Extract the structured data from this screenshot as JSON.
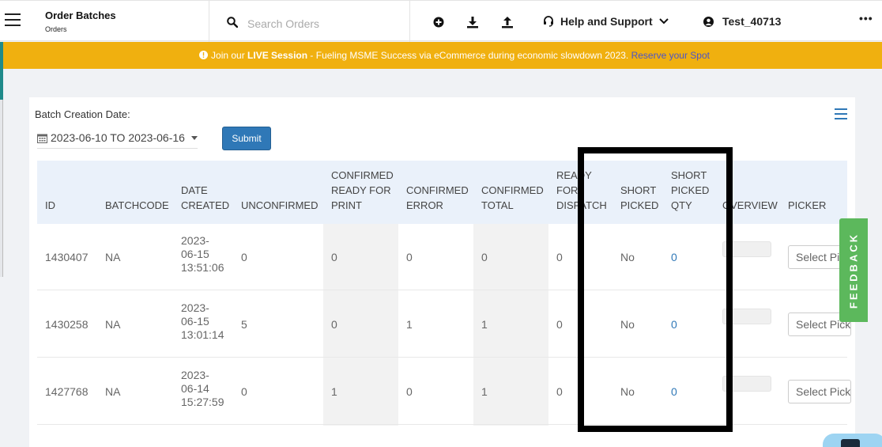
{
  "header": {
    "title": "Order Batches",
    "subtitle": "Orders",
    "search_placeholder": "Search Orders",
    "help_label": "Help and Support",
    "user_label": "Test_40713",
    "more_label": "•••"
  },
  "banner": {
    "prefix": "Join our ",
    "highlight": "LIVE Session",
    "text": " - Fueling MSME Success via eCommerce during economic slowdown 2023. ",
    "link": "Reserve your Spot"
  },
  "filters": {
    "date_label": "Batch Creation Date:",
    "date_range": "2023-06-10 TO 2023-06-16",
    "submit_label": "Submit"
  },
  "table": {
    "columns": [
      [
        "ID"
      ],
      [
        "BATCHCODE"
      ],
      [
        "DATE",
        "CREATED"
      ],
      [
        "UNCONFIRMED"
      ],
      [
        "CONFIRMED",
        "READY FOR",
        "PRINT"
      ],
      [
        "CONFIRMED",
        "ERROR"
      ],
      [
        "CONFIRMED",
        "TOTAL"
      ],
      [
        "READY",
        "FOR",
        "DISPATCH"
      ],
      [
        "SHORT",
        "PICKED"
      ],
      [
        "SHORT",
        "PICKED",
        "QTY"
      ],
      [
        "OVERVIEW"
      ],
      [
        "PICKER"
      ]
    ],
    "rows": [
      {
        "id": "1430407",
        "batchcode": "NA",
        "date": [
          "2023-",
          "06-15",
          "13:51:06"
        ],
        "unconfirmed": "0",
        "ready_print": "0",
        "error": "0",
        "total": "0",
        "ready_dispatch": "0",
        "short_picked": "No",
        "short_qty": "0",
        "picker": "Select Picker"
      },
      {
        "id": "1430258",
        "batchcode": "NA",
        "date": [
          "2023-",
          "06-15",
          "13:01:14"
        ],
        "unconfirmed": "5",
        "ready_print": "0",
        "error": "1",
        "total": "1",
        "ready_dispatch": "0",
        "short_picked": "No",
        "short_qty": "0",
        "picker": "Select Picker"
      },
      {
        "id": "1427768",
        "batchcode": "NA",
        "date": [
          "2023-",
          "06-14",
          "15:27:59"
        ],
        "unconfirmed": "0",
        "ready_print": "1",
        "error": "0",
        "total": "1",
        "ready_dispatch": "0",
        "short_picked": "No",
        "short_qty": "0",
        "picker": "Select Picker"
      }
    ]
  },
  "feedback_label": "FEEDBACK",
  "colors": {
    "banner": "#f0b00f",
    "primary": "#2f78b7",
    "feedback": "#5cb85c",
    "header_bg": "#eaf1fa"
  }
}
